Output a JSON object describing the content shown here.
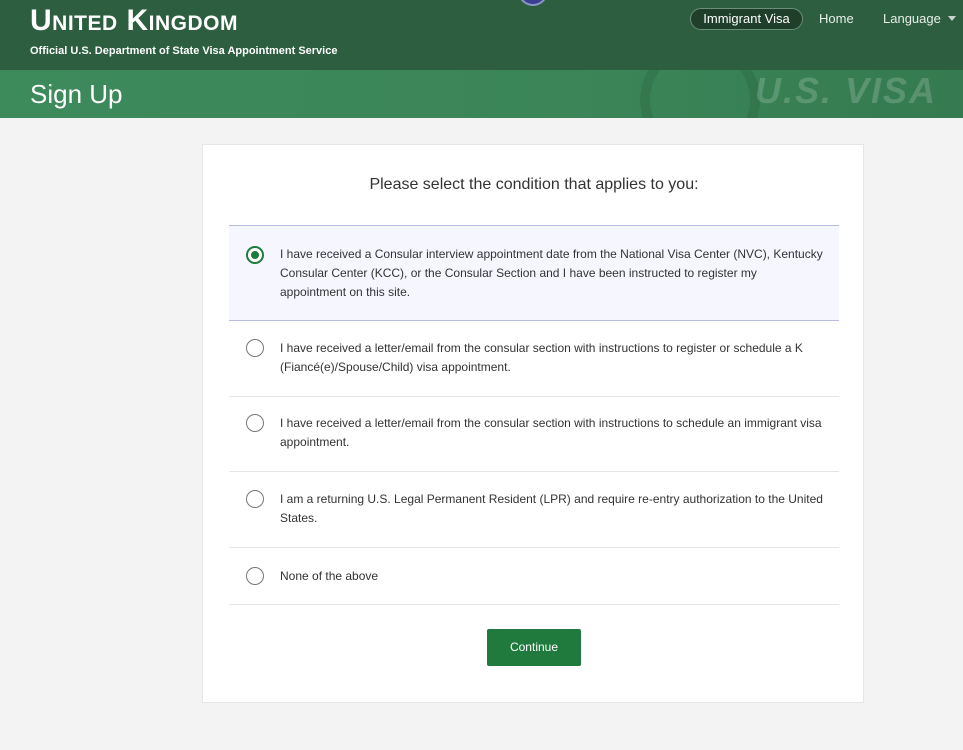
{
  "header": {
    "country": "United Kingdom",
    "subtitle": "Official U.S. Department of State Visa Appointment Service",
    "visa_type": "Immigrant Visa",
    "home_label": "Home",
    "language_label": "Language"
  },
  "banner": {
    "title": "Sign Up",
    "watermark": "U.S. VISA"
  },
  "form": {
    "prompt": "Please select the condition that applies to you:",
    "selected_index": 0,
    "options": [
      {
        "label": "I have received a Consular interview appointment date from the National Visa Center (NVC), Kentucky Consular Center (KCC), or the Consular Section and I have been instructed to register my appointment on this site."
      },
      {
        "label": "I have received a letter/email from the consular section with instructions to register or schedule a K (Fiancé(e)/Spouse/Child) visa appointment."
      },
      {
        "label": "I have received a letter/email from the consular section with instructions to schedule an immigrant visa appointment."
      },
      {
        "label": "I am a returning U.S. Legal Permanent Resident (LPR) and require re-entry authorization to the United States."
      },
      {
        "label": "None of the above"
      }
    ],
    "continue_label": "Continue"
  },
  "colors": {
    "header_bg": "#2c5e3f",
    "banner_bg": "#3b8559",
    "accent": "#207a3e",
    "selected_bg": "#f5f6ff"
  }
}
